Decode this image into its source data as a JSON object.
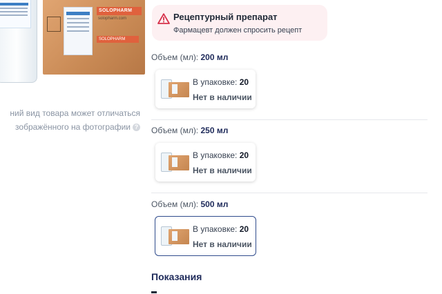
{
  "product_image": {
    "brand": "SOLOPHARM",
    "brand_site": "solopharm.com",
    "alt": "product-photo"
  },
  "disclaimer": {
    "line1": "ний вид товара может отличаться",
    "line2": "зображённого на фотографии",
    "help_icon": "question-icon"
  },
  "rx": {
    "icon": "warning-triangle-icon",
    "title": "Рецептурный препарат",
    "subtitle": "Фармацевт должен спросить рецепт",
    "colors": {
      "background": "#fdf0f2",
      "icon": "#d6304a"
    }
  },
  "options": [
    {
      "volume_label": "Объем (мл):",
      "volume_value": "200 мл",
      "pack_label": "В упаковке:",
      "pack_value": "20",
      "stock": "Нет в наличии",
      "selected": false
    },
    {
      "volume_label": "Объем (мл):",
      "volume_value": "250 мл",
      "pack_label": "В упаковке:",
      "pack_value": "20",
      "stock": "Нет в наличии",
      "selected": false
    },
    {
      "volume_label": "Объем (мл):",
      "volume_value": "500 мл",
      "pack_label": "В упаковке:",
      "pack_value": "20",
      "stock": "Нет в наличии",
      "selected": true
    }
  ],
  "sections": {
    "indications_title": "Показания"
  },
  "colors": {
    "accent": "#1e2a5a",
    "selected_border": "#2f4b8c"
  }
}
